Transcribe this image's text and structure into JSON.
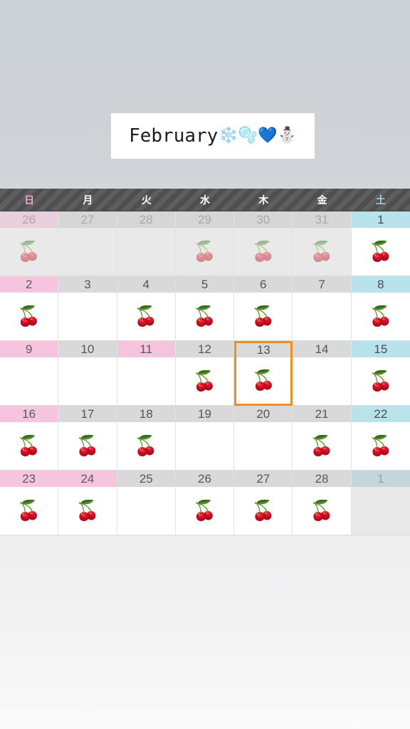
{
  "title": {
    "month_label": "February",
    "emojis": "❄️🫧💙⛄"
  },
  "weekdays": [
    {
      "label": "日",
      "kind": "sun"
    },
    {
      "label": "月",
      "kind": "weekday"
    },
    {
      "label": "火",
      "kind": "weekday"
    },
    {
      "label": "水",
      "kind": "weekday"
    },
    {
      "label": "木",
      "kind": "weekday"
    },
    {
      "label": "金",
      "kind": "weekday"
    },
    {
      "label": "土",
      "kind": "sat"
    }
  ],
  "sticker": {
    "name": "cherries-sticker",
    "glyph": "🍒"
  },
  "selected_day": 13,
  "colors": {
    "sunday_header": "#f4c5dc",
    "saturday_header": "#b8e2ec",
    "weekday_header": "#d9d9d9",
    "selected_border": "#f08e22",
    "stripe_dark": "#4f4f4f",
    "stripe_light": "#5e5e5e"
  },
  "weeks": [
    [
      {
        "num": "26",
        "kind": "sun",
        "out": true,
        "sticker": true,
        "selected": false
      },
      {
        "num": "27",
        "kind": "weekday",
        "out": true,
        "sticker": false,
        "selected": false
      },
      {
        "num": "28",
        "kind": "weekday",
        "out": true,
        "sticker": false,
        "selected": false
      },
      {
        "num": "29",
        "kind": "weekday",
        "out": true,
        "sticker": true,
        "selected": false
      },
      {
        "num": "30",
        "kind": "weekday",
        "out": true,
        "sticker": true,
        "selected": false
      },
      {
        "num": "31",
        "kind": "weekday",
        "out": true,
        "sticker": true,
        "selected": false
      },
      {
        "num": "1",
        "kind": "sat",
        "out": false,
        "sticker": true,
        "selected": false
      }
    ],
    [
      {
        "num": "2",
        "kind": "sun",
        "out": false,
        "sticker": true,
        "selected": false
      },
      {
        "num": "3",
        "kind": "weekday",
        "out": false,
        "sticker": false,
        "selected": false
      },
      {
        "num": "4",
        "kind": "weekday",
        "out": false,
        "sticker": true,
        "selected": false
      },
      {
        "num": "5",
        "kind": "weekday",
        "out": false,
        "sticker": true,
        "selected": false
      },
      {
        "num": "6",
        "kind": "weekday",
        "out": false,
        "sticker": true,
        "selected": false
      },
      {
        "num": "7",
        "kind": "weekday",
        "out": false,
        "sticker": false,
        "selected": false
      },
      {
        "num": "8",
        "kind": "sat",
        "out": false,
        "sticker": true,
        "selected": false
      }
    ],
    [
      {
        "num": "9",
        "kind": "sun",
        "out": false,
        "sticker": false,
        "selected": false
      },
      {
        "num": "10",
        "kind": "weekday",
        "out": false,
        "sticker": false,
        "selected": false
      },
      {
        "num": "11",
        "kind": "holiday",
        "out": false,
        "sticker": false,
        "selected": false
      },
      {
        "num": "12",
        "kind": "weekday",
        "out": false,
        "sticker": true,
        "selected": false
      },
      {
        "num": "13",
        "kind": "weekday",
        "out": false,
        "sticker": true,
        "selected": true
      },
      {
        "num": "14",
        "kind": "weekday",
        "out": false,
        "sticker": false,
        "selected": false
      },
      {
        "num": "15",
        "kind": "sat",
        "out": false,
        "sticker": true,
        "selected": false
      }
    ],
    [
      {
        "num": "16",
        "kind": "sun",
        "out": false,
        "sticker": true,
        "selected": false
      },
      {
        "num": "17",
        "kind": "weekday",
        "out": false,
        "sticker": true,
        "selected": false
      },
      {
        "num": "18",
        "kind": "weekday",
        "out": false,
        "sticker": true,
        "selected": false
      },
      {
        "num": "19",
        "kind": "weekday",
        "out": false,
        "sticker": false,
        "selected": false
      },
      {
        "num": "20",
        "kind": "weekday",
        "out": false,
        "sticker": false,
        "selected": false
      },
      {
        "num": "21",
        "kind": "weekday",
        "out": false,
        "sticker": true,
        "selected": false
      },
      {
        "num": "22",
        "kind": "sat",
        "out": false,
        "sticker": true,
        "selected": false
      }
    ],
    [
      {
        "num": "23",
        "kind": "sun",
        "out": false,
        "sticker": true,
        "selected": false
      },
      {
        "num": "24",
        "kind": "holiday",
        "out": false,
        "sticker": true,
        "selected": false
      },
      {
        "num": "25",
        "kind": "weekday",
        "out": false,
        "sticker": false,
        "selected": false
      },
      {
        "num": "26",
        "kind": "weekday",
        "out": false,
        "sticker": true,
        "selected": false
      },
      {
        "num": "27",
        "kind": "weekday",
        "out": false,
        "sticker": true,
        "selected": false
      },
      {
        "num": "28",
        "kind": "weekday",
        "out": false,
        "sticker": true,
        "selected": false
      },
      {
        "num": "1",
        "kind": "sat",
        "out": true,
        "sticker": false,
        "selected": false
      }
    ]
  ]
}
